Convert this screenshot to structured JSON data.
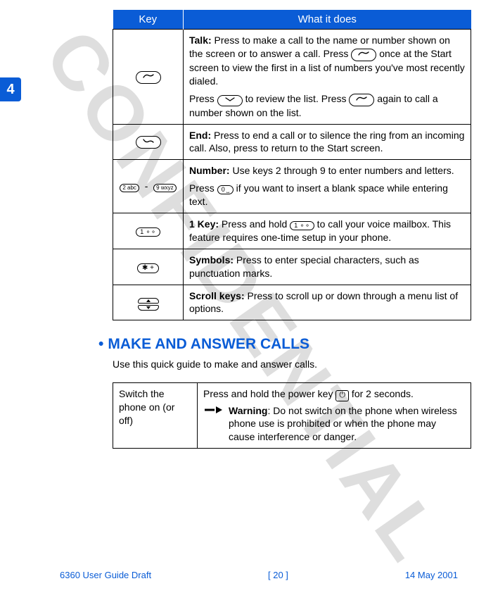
{
  "tab_number": "4",
  "watermark": "CONFIDENTIAL",
  "table1": {
    "headers": {
      "key": "Key",
      "desc": "What it does"
    },
    "rows": [
      {
        "icon": "talk-key-icon",
        "para1_prefix": "Talk:",
        "para1_a": " Press to make a call to the name or number shown on the screen or to answer a call. Press ",
        "para1_b": " once at the Start screen to view the first in a list of numbers you've most recently dialed.",
        "para2_a": "Press ",
        "para2_b": " to review the list. Press ",
        "para2_c": " again to call a number shown on the list."
      },
      {
        "icon": "end-key-icon",
        "para1_prefix": "End:",
        "para1": " Press to end a call or to silence the ring from an incoming call. Also, press to return to the Start screen."
      },
      {
        "icon": "number-keys-icon",
        "para1_prefix": "Number:",
        "para1": " Use keys 2 through 9 to enter numbers and letters.",
        "para2_a": "Press ",
        "para2_b": " if you want to insert a blank space while entering text."
      },
      {
        "icon": "one-key-icon",
        "para1_prefix": "1 Key:",
        "para1_a": " Press and hold ",
        "para1_b": " to call your voice mailbox. This feature requires one-time setup in your phone."
      },
      {
        "icon": "star-key-icon",
        "para1_prefix": "Symbols:",
        "para1": " Press to enter special characters, such as punctuation marks."
      },
      {
        "icon": "scroll-keys-icon",
        "para1_prefix": "Scroll keys:",
        "para1": " Press to scroll up or down through a menu list of options."
      }
    ]
  },
  "section": {
    "bullet": "•",
    "title": "MAKE AND ANSWER CALLS",
    "intro": "Use this quick guide to make and answer calls."
  },
  "table2": {
    "row1": {
      "left": "Switch the phone on (or off)",
      "right_a": "Press and hold the power key ",
      "right_b": " for 2 seconds.",
      "warn_prefix": "Warning",
      "warn": ": Do not switch on the phone when wireless phone use is prohibited or when the phone may cause interference or danger."
    }
  },
  "footer": {
    "left": "6360 User Guide Draft",
    "center": "[ 20 ]",
    "right": "14 May 2001"
  }
}
